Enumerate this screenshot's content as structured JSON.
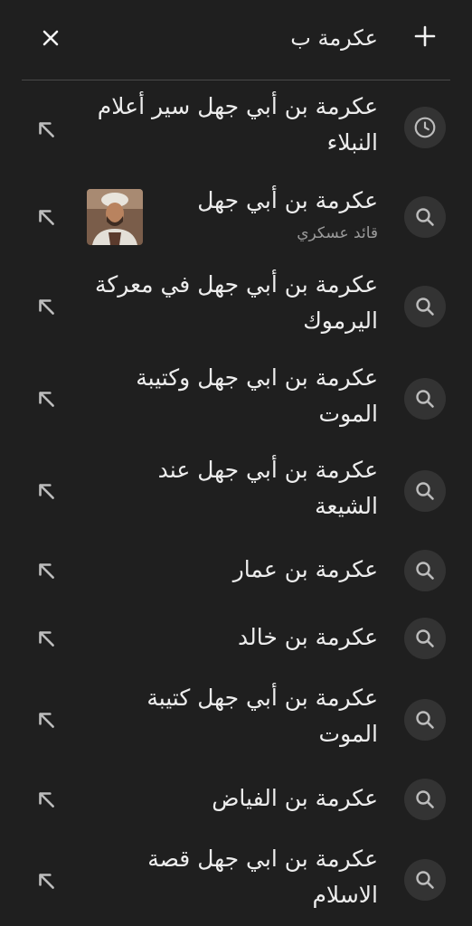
{
  "search": {
    "query": "عكرمة ب"
  },
  "icons": {
    "close": "close-icon",
    "add": "plus-icon",
    "history": "history-icon",
    "search": "search-icon",
    "fill_query": "arrow-up-left-icon"
  },
  "colors": {
    "background": "#1f1f1f",
    "icon_circle": "#333333",
    "text": "#ededed",
    "subtext": "#9a9a9a"
  },
  "suggestions": [
    {
      "text": "عكرمة بن أبي جهل سير أعلام النبلاء",
      "type": "history"
    },
    {
      "text": "عكرمة بن أبي جهل",
      "subtitle": "قائد عسكري",
      "type": "search",
      "has_thumbnail": true
    },
    {
      "text": "عكرمة بن أبي جهل في معركة اليرموك",
      "type": "search"
    },
    {
      "text": "عكرمة بن ابي جهل وكتيبة الموت",
      "type": "search"
    },
    {
      "text": "عكرمة بن أبي جهل عند الشيعة",
      "type": "search"
    },
    {
      "text": "عكرمة بن عمار",
      "type": "search"
    },
    {
      "text": "عكرمة بن خالد",
      "type": "search"
    },
    {
      "text": "عكرمة بن أبي جهل كتيبة الموت",
      "type": "search"
    },
    {
      "text": "عكرمة بن الفياض",
      "type": "search"
    },
    {
      "text": "عكرمة بن ابي جهل قصة الاسلام",
      "type": "search"
    }
  ]
}
